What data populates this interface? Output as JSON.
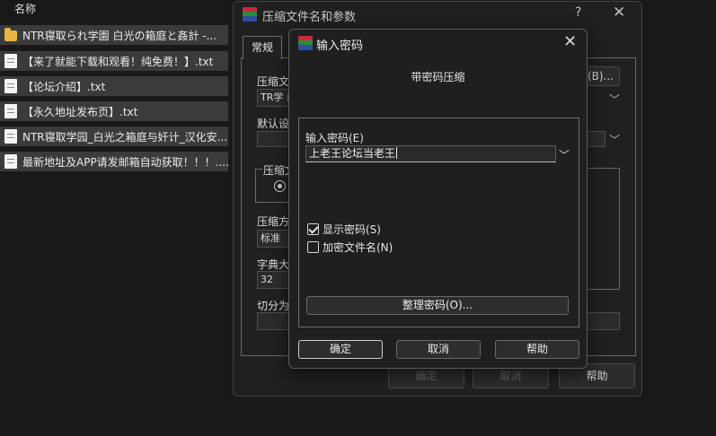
{
  "colors": {
    "background": "#191919",
    "dialog": "#202020",
    "row": "#3b3b3b",
    "icon_red": "#c9283e",
    "icon_green": "#2e8b3a",
    "icon_blue": "#2c4fa0"
  },
  "file_list": {
    "header": "名称",
    "rows": [
      {
        "icon": "folder-icon",
        "name": "NTR寝取られ学園 白光の箱庭と姦計 -..."
      },
      {
        "icon": "document-icon",
        "name": "【来了就能下载和观看！纯免费！】.txt"
      },
      {
        "icon": "document-icon",
        "name": "【论坛介绍】.txt"
      },
      {
        "icon": "document-icon",
        "name": "【永久地址发布页】.txt"
      },
      {
        "icon": "document-icon",
        "name": "NTR寝取学园_白光之箱庭与奸计_汉化安..."
      },
      {
        "icon": "document-icon",
        "name": "最新地址及APP请发邮箱自动获取！！！...."
      }
    ]
  },
  "main_dialog": {
    "title": "压缩文件名和参数",
    "help_glyph": "?",
    "close_glyph": "✕",
    "tab_general": "常规",
    "archive_name_label": "压缩文",
    "archive_name_value": "TR学 白",
    "browse_button_fragment": "(B)...",
    "default_settings_label": "默认设",
    "format_group_label": "压缩文",
    "method_label": "压缩方",
    "method_value": "标准",
    "dict_label": "字典大",
    "dict_value": "32",
    "split_label": "切分为",
    "ok": "确定",
    "cancel": "取消",
    "help": "帮助"
  },
  "password_dialog": {
    "title": "输入密码",
    "close_glyph": "✕",
    "subtitle": "带密码压缩",
    "password_label": "输入密码(E)",
    "password_value": "上老王论坛当老王",
    "show_password_label": "显示密码(S)",
    "show_password_checked": true,
    "encrypt_names_label": "加密文件名(N)",
    "encrypt_names_checked": false,
    "organize_button": "整理密码(O)...",
    "ok": "确定",
    "cancel": "取消",
    "help": "帮助"
  }
}
